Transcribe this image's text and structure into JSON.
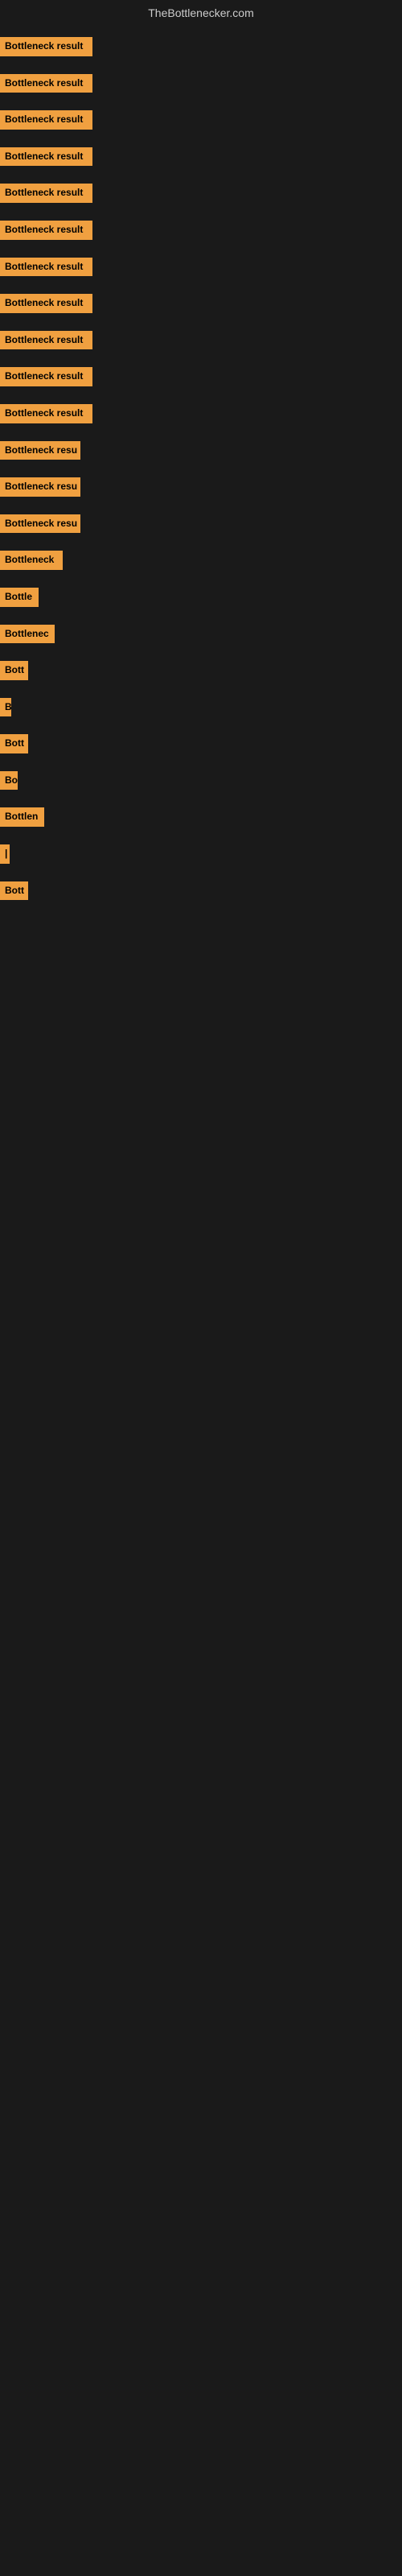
{
  "header": {
    "title": "TheBottlenecker.com"
  },
  "bars": [
    {
      "id": 1,
      "label": "Bottleneck result",
      "width": 115
    },
    {
      "id": 2,
      "label": "Bottleneck result",
      "width": 115
    },
    {
      "id": 3,
      "label": "Bottleneck result",
      "width": 115
    },
    {
      "id": 4,
      "label": "Bottleneck result",
      "width": 115
    },
    {
      "id": 5,
      "label": "Bottleneck result",
      "width": 115
    },
    {
      "id": 6,
      "label": "Bottleneck result",
      "width": 115
    },
    {
      "id": 7,
      "label": "Bottleneck result",
      "width": 115
    },
    {
      "id": 8,
      "label": "Bottleneck result",
      "width": 115
    },
    {
      "id": 9,
      "label": "Bottleneck result",
      "width": 115
    },
    {
      "id": 10,
      "label": "Bottleneck result",
      "width": 115
    },
    {
      "id": 11,
      "label": "Bottleneck result",
      "width": 115
    },
    {
      "id": 12,
      "label": "Bottleneck resu",
      "width": 100
    },
    {
      "id": 13,
      "label": "Bottleneck resu",
      "width": 100
    },
    {
      "id": 14,
      "label": "Bottleneck resu",
      "width": 100
    },
    {
      "id": 15,
      "label": "Bottleneck",
      "width": 78
    },
    {
      "id": 16,
      "label": "Bottle",
      "width": 48
    },
    {
      "id": 17,
      "label": "Bottlenec",
      "width": 68
    },
    {
      "id": 18,
      "label": "Bott",
      "width": 35
    },
    {
      "id": 19,
      "label": "B",
      "width": 14
    },
    {
      "id": 20,
      "label": "Bott",
      "width": 35
    },
    {
      "id": 21,
      "label": "Bo",
      "width": 22
    },
    {
      "id": 22,
      "label": "Bottlen",
      "width": 55
    },
    {
      "id": 23,
      "label": "|",
      "width": 8
    },
    {
      "id": 24,
      "label": "Bott",
      "width": 35
    }
  ],
  "colors": {
    "bar_bg": "#f0a040",
    "bar_text": "#000000",
    "page_bg": "#1a1a1a",
    "header_text": "#cccccc"
  }
}
